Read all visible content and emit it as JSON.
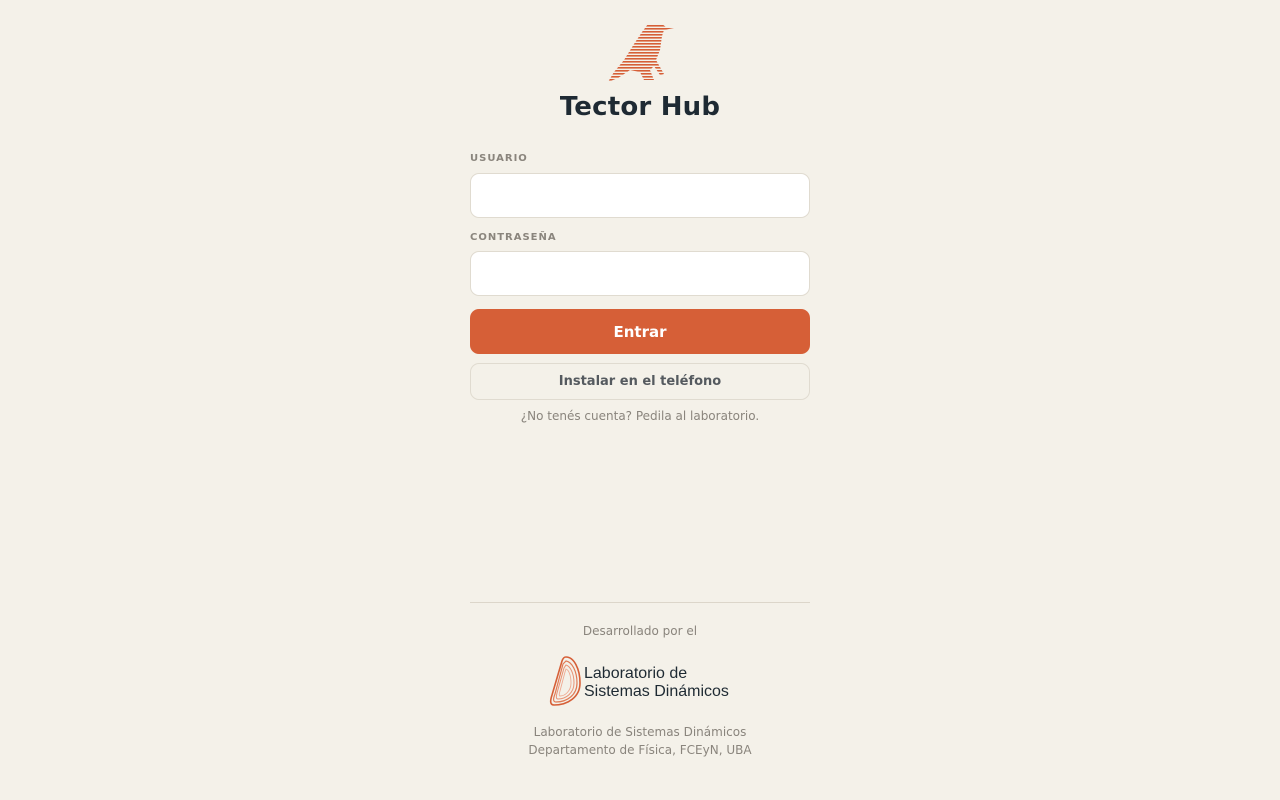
{
  "app": {
    "title": "Tector Hub",
    "logo_icon": "bird-icon",
    "accent_color": "#d65f37"
  },
  "login": {
    "username_label": "USUARIO",
    "username_value": "",
    "password_label": "CONTRASEÑA",
    "password_value": "",
    "submit_label": "Entrar",
    "install_label": "Instalar en el teléfono",
    "no_account_hint": "¿No tenés cuenta? Pedila al laboratorio."
  },
  "footer": {
    "developed_by": "Desarrollado por el",
    "lab_logo_line1": "Laboratorio de",
    "lab_logo_line2": "Sistemas Dinámicos",
    "lab_name": "Laboratorio de Sistemas Dinámicos",
    "department": "Departamento de Física, FCEyN, UBA"
  }
}
